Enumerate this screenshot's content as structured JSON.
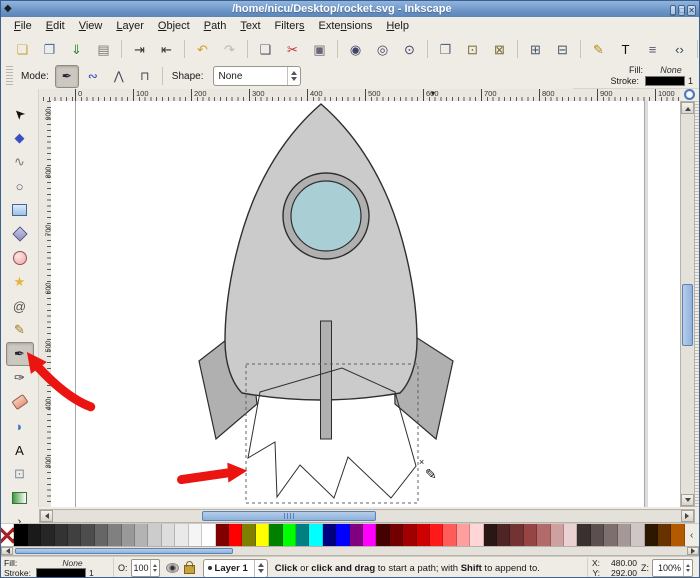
{
  "window": {
    "title": "/home/nicu/Desktop/rocket.svg - Inkscape",
    "icon_glyph": "◆",
    "controls": [
      {
        "name": "minimize-button",
        "glyph": "_"
      },
      {
        "name": "maximize-button",
        "glyph": "□"
      },
      {
        "name": "close-button",
        "glyph": "✕"
      }
    ]
  },
  "menu": {
    "items": [
      {
        "label": "File",
        "u": 0
      },
      {
        "label": "Edit",
        "u": 0
      },
      {
        "label": "View",
        "u": 0
      },
      {
        "label": "Layer",
        "u": 0
      },
      {
        "label": "Object",
        "u": 0
      },
      {
        "label": "Path",
        "u": 0
      },
      {
        "label": "Text",
        "u": 0
      },
      {
        "label": "Filters",
        "u": 6
      },
      {
        "label": "Extensions",
        "u": 4
      },
      {
        "label": "Help",
        "u": 0
      }
    ]
  },
  "command_bar": {
    "groups": [
      [
        {
          "name": "new-document",
          "glyph": "❏",
          "color": "#c9a73c"
        },
        {
          "name": "open-document",
          "glyph": "❐",
          "color": "#4a6fa5"
        },
        {
          "name": "save-document",
          "glyph": "⇓",
          "color": "#2e8b2e"
        },
        {
          "name": "print-document",
          "glyph": "▤",
          "color": "#7a7a72"
        }
      ],
      [
        {
          "name": "import-document",
          "glyph": "⇥",
          "color": "#333333"
        },
        {
          "name": "export-document",
          "glyph": "⇤",
          "color": "#333333"
        }
      ],
      [
        {
          "name": "undo",
          "glyph": "↶",
          "color": "#d79b2a"
        },
        {
          "name": "redo",
          "glyph": "↷",
          "color": "#bcb8b0"
        }
      ],
      [
        {
          "name": "copy",
          "glyph": "❑",
          "color": "#555566"
        },
        {
          "name": "cut",
          "glyph": "✂",
          "color": "#c03030"
        },
        {
          "name": "paste",
          "glyph": "▣",
          "color": "#666677"
        }
      ],
      [
        {
          "name": "zoom-selection",
          "glyph": "◉",
          "color": "#444466"
        },
        {
          "name": "zoom-drawing",
          "glyph": "◎",
          "color": "#444466"
        },
        {
          "name": "zoom-page",
          "glyph": "⊙",
          "color": "#444466"
        }
      ],
      [
        {
          "name": "duplicate",
          "glyph": "❒",
          "color": "#556677"
        },
        {
          "name": "clone",
          "glyph": "⊡",
          "color": "#786a34"
        },
        {
          "name": "unlink-clone",
          "glyph": "⊠",
          "color": "#786a34"
        }
      ],
      [
        {
          "name": "group",
          "glyph": "⊞",
          "color": "#445566"
        },
        {
          "name": "ungroup",
          "glyph": "⊟",
          "color": "#445566"
        }
      ],
      [
        {
          "name": "fill-stroke-dialog",
          "glyph": "✎",
          "color": "#b08c20"
        },
        {
          "name": "text-dialog",
          "glyph": "T",
          "color": "#111111"
        },
        {
          "name": "layers-dialog",
          "glyph": "≡",
          "color": "#555577"
        },
        {
          "name": "xml-editor",
          "glyph": "‹›",
          "color": "#334455"
        }
      ],
      [
        {
          "name": "align-dialog",
          "glyph": "≣",
          "color": "#a03030"
        }
      ]
    ],
    "overflow_glyph": "⌄"
  },
  "tool_options": {
    "mode_label": "Mode:",
    "modes": [
      {
        "name": "bezier-mode",
        "glyph": "✒",
        "color": "#222233",
        "active": true
      },
      {
        "name": "spiro-mode",
        "glyph": "∾",
        "color": "#2244bb",
        "active": false
      },
      {
        "name": "straight-segments-mode",
        "glyph": "⋀",
        "color": "#444455",
        "active": false
      },
      {
        "name": "paraxial-segments-mode",
        "glyph": "⊓",
        "color": "#444455",
        "active": false
      }
    ],
    "shape_label": "Shape:",
    "shape_value": "None"
  },
  "style_panel": {
    "fill_label": "Fill:",
    "fill_value": "None",
    "stroke_label": "Stroke:",
    "stroke_width": "1"
  },
  "toolbox": {
    "tools": [
      {
        "name": "selector-tool",
        "glyph": "➤",
        "color": "#111111",
        "rot": -135
      },
      {
        "name": "node-tool",
        "glyph": "◆",
        "color": "#3b4fc0"
      },
      {
        "name": "tweak-tool",
        "glyph": "∿",
        "color": "#777777"
      },
      {
        "name": "zoom-tool",
        "glyph": "○",
        "color": "#445566"
      },
      {
        "name": "rectangle-tool",
        "css": "rect"
      },
      {
        "name": "box3d-tool",
        "css": "cube"
      },
      {
        "name": "ellipse-tool",
        "css": "circle"
      },
      {
        "name": "star-tool",
        "glyph": "★",
        "color": "#e0b63c"
      },
      {
        "name": "spiral-tool",
        "glyph": "@",
        "color": "#555555"
      },
      {
        "name": "pencil-tool",
        "glyph": "✎",
        "color": "#9a7d20"
      },
      {
        "name": "bezier-tool",
        "glyph": "✒",
        "color": "#222233",
        "active": true
      },
      {
        "name": "calligraphy-tool",
        "glyph": "✑",
        "color": "#333344"
      },
      {
        "name": "eraser-tool",
        "css": "eraser"
      },
      {
        "name": "bucket-tool",
        "glyph": "◗",
        "color": "#3a7fc2"
      },
      {
        "name": "text-tool",
        "glyph": "A",
        "color": "#111111"
      },
      {
        "name": "connector-tool",
        "glyph": "⊡",
        "color": "#7a8aa0"
      },
      {
        "name": "gradient-tool",
        "css": "gradient"
      }
    ],
    "more_glyph": "›"
  },
  "rulers": {
    "h_labels": [
      "0",
      "100",
      "200",
      "300",
      "400",
      "500",
      "600",
      "700",
      "800",
      "900",
      "1000"
    ],
    "v_labels": [
      "900",
      "800",
      "700",
      "600",
      "500",
      "400",
      "300"
    ]
  },
  "palette": {
    "scroll_left_glyph": "‹",
    "colors": [
      "none",
      "#000000",
      "#1a1a1a",
      "#262626",
      "#333333",
      "#404040",
      "#4d4d4d",
      "#666666",
      "#808080",
      "#999999",
      "#b3b3b3",
      "#cccccc",
      "#dddddd",
      "#e9e9e9",
      "#f5f5f5",
      "#ffffff",
      "#800000",
      "#ff0000",
      "#808000",
      "#ffff00",
      "#008000",
      "#00ff00",
      "#008080",
      "#00ffff",
      "#000080",
      "#0000ff",
      "#800080",
      "#ff00ff",
      "#450000",
      "#730000",
      "#a10000",
      "#cf0000",
      "#ff1a1a",
      "#ff5c5c",
      "#ff9e9e",
      "#ffd6d6",
      "#2b1616",
      "#4f2424",
      "#733333",
      "#974444",
      "#b36a6a",
      "#cfa0a0",
      "#ead2d2",
      "#3a3030",
      "#5c4f4f",
      "#7e6f6f",
      "#a59898",
      "#cfc6c6",
      "#2e1700",
      "#663300",
      "#b35900"
    ]
  },
  "statusbar": {
    "fill_label": "Fill:",
    "fill_value": "None",
    "stroke_label": "Stroke:",
    "stroke_width": "1",
    "opacity_label": "O:",
    "opacity_value": "100",
    "layer_name": "Layer 1",
    "message_parts": [
      {
        "text": "Click",
        "bold": true
      },
      {
        "text": " or ",
        "bold": false
      },
      {
        "text": "click and drag",
        "bold": true
      },
      {
        "text": " to start a path; with ",
        "bold": false
      },
      {
        "text": "Shift",
        "bold": true
      },
      {
        "text": " to append to.",
        "bold": false
      }
    ],
    "x_label": "X:",
    "x_value": "480.00",
    "y_label": "Y:",
    "y_value": "292.00",
    "zoom_label": "Z:",
    "zoom_value": "100%"
  },
  "canvas": {
    "colors": {
      "body": "#cbcbcb",
      "fins": "#b0b0b0",
      "window": "#a9ced3",
      "outline": "#2e2e2e",
      "arrow": "#ea1411"
    },
    "cursor_glyph": "✎",
    "cursor_mark": "×"
  }
}
